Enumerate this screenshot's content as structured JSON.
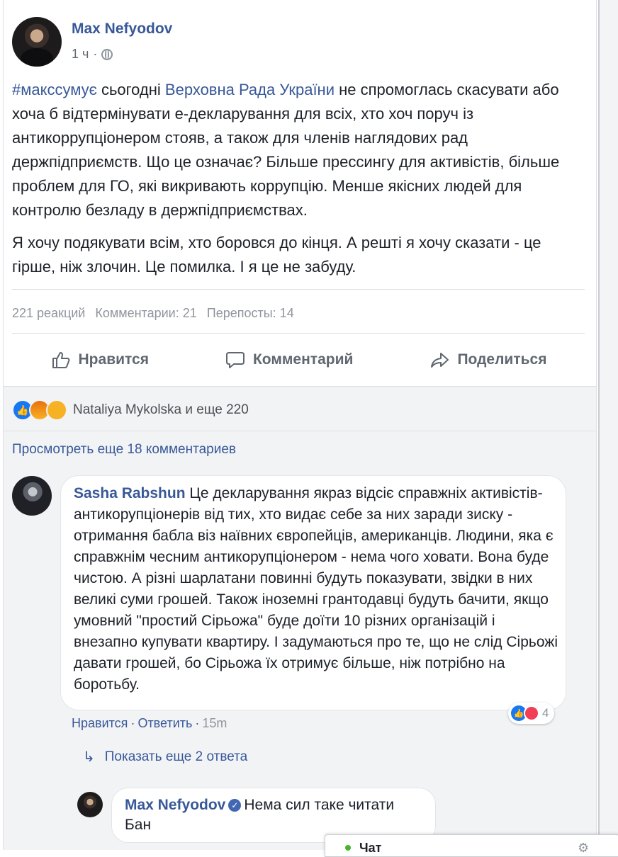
{
  "post": {
    "author": "Max Nefyodov",
    "time": "1 ч",
    "separator": "·",
    "paragraph1": {
      "hashtag": "#макссумує",
      "t1": " сьогодні ",
      "org_link": "Верховна Рада України",
      "t2": " не спромоглась скасувати або хоча б відтермінувати е-декларування для всіх, хто хоч поруч із антикоррупціонером стояв, а також для членів наглядових рад держпідприємств. Що це означає? Більше прессингу для активістів, більше проблем для ГО, які викривають коррупцію. Менше якісних людей для контролю безладу в держпідприємствах."
    },
    "paragraph2": "Я хочу подякувати всім, хто боровся до кінця. А решті я хочу сказати - це гірше, ніж злочин. Це помилка. І я це не забуду.",
    "stats": {
      "reactions": "221 реакций",
      "comments": "Комментарии: 21",
      "shares": "Перепосты: 14"
    },
    "actions": {
      "like": "Нравится",
      "comment": "Комментарий",
      "share": "Поделиться"
    }
  },
  "reactions_summary": "Nataliya Mykolska и еще 220",
  "view_more": "Просмотреть еще 18 комментариев",
  "comment": {
    "author": "Sasha Rabshun",
    "text": " Це декларування якраз відсіє справжніх активістів-антикорупціонерів від тих, хто видає себе за них заради зиску - отримання бабла віз наївних європейців, американців. Людини, яка є справжнім чесним антикорупціонером - нема чого ховати. Вона буде чистою. А різні шарлатани повинні будуть показувати, звідки в них великі суми грошей. Також іноземні грантодавці будуть бачити, якщо умовний \"простий Сірьожа\" буде доїти 10 різних організацій і внезапно купувати квартиру. І задумаються про те, що не слід Сірьожі давати грошей, бо Сірьожа їх отримує більше, ніж потрібно на боротьбу.",
    "reaction_count": "4",
    "like": "Нравится",
    "dot": " · ",
    "reply": "Ответить",
    "time": "15m",
    "show_replies": "Показать еще 2 ответа"
  },
  "reply": {
    "author": "Max Nefyodov",
    "line1": "Нема сил таке читати",
    "line2": "Бан"
  },
  "overlay": {
    "label": "Чат"
  },
  "icons": {
    "globe": "globe-icon",
    "like": "thumbs-up-icon",
    "comment": "speech-bubble-icon",
    "share": "share-arrow-icon",
    "verified": "verified-badge-icon",
    "reply_arrow": "reply-arrow-icon",
    "gear": "gear-icon"
  },
  "colors": {
    "link": "#385898",
    "like_blue": "#1877f2",
    "muted": "#90949c",
    "comments_bg": "#f2f3f5"
  }
}
